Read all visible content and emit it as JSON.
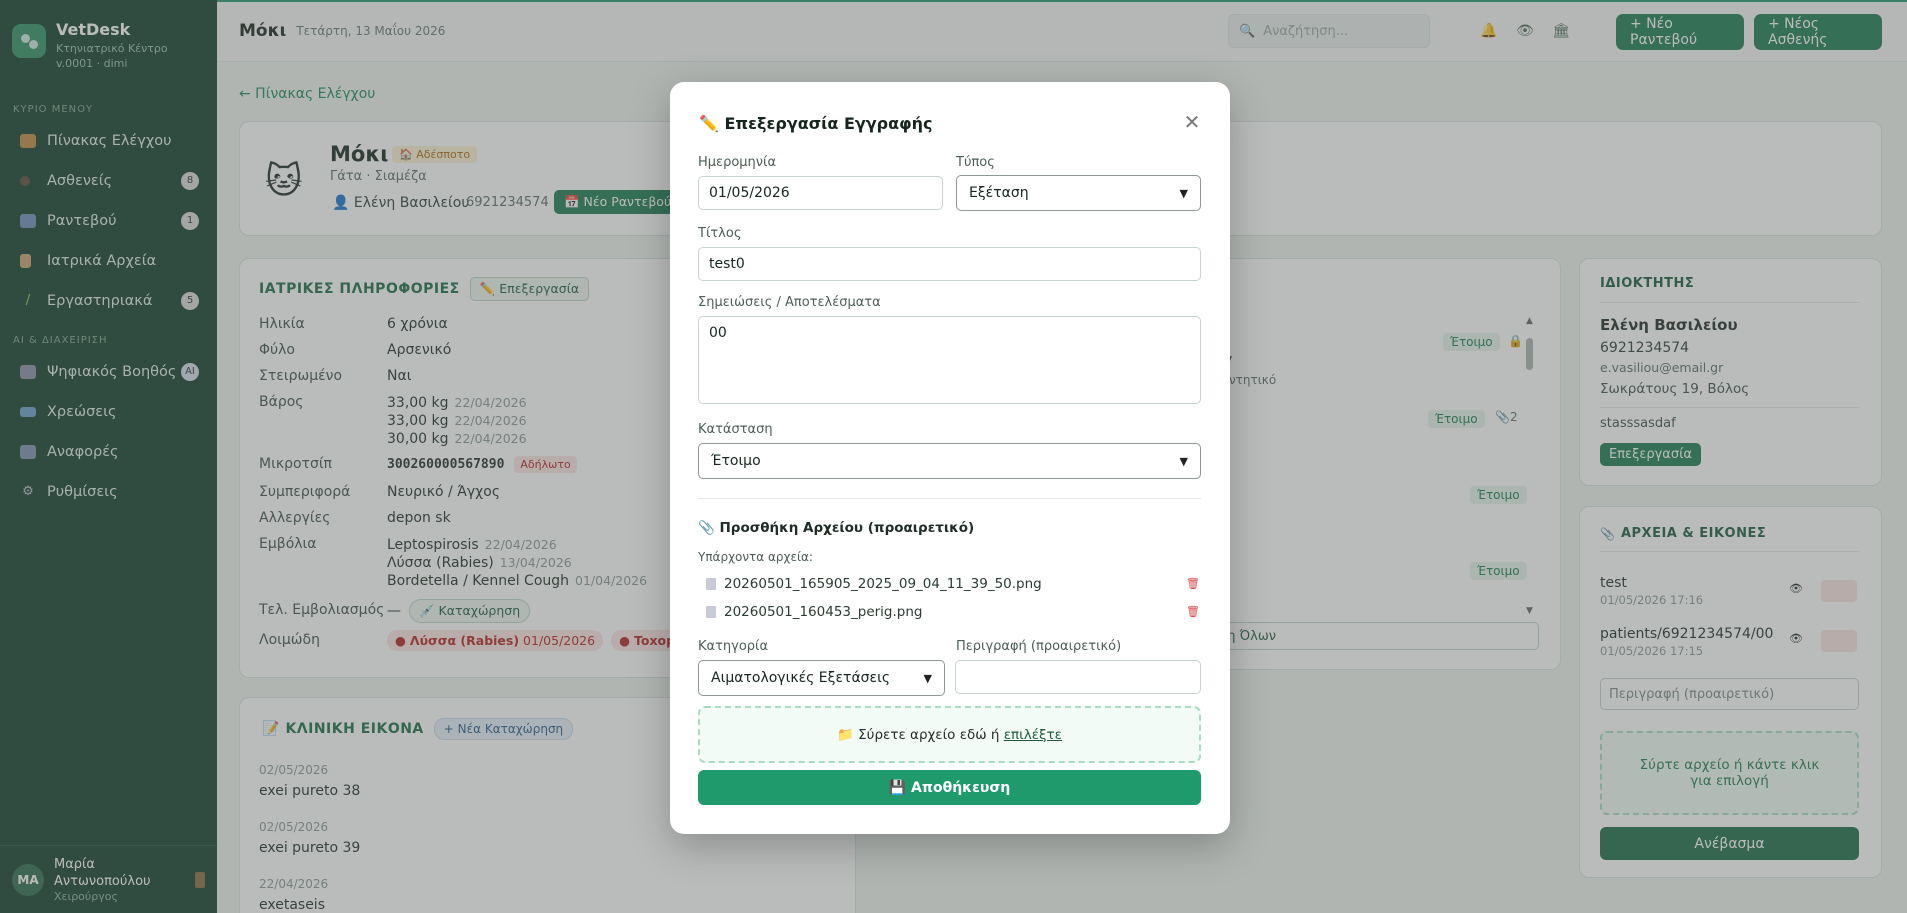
{
  "brand": {
    "name": "VetDesk",
    "subtitle": "Κτηνιατρικό Κέντρο",
    "version": "v.0001 · dimi"
  },
  "nav": {
    "section_main": "ΚΥΡΙΟ ΜΕΝΟΥ",
    "items_main": [
      {
        "label": "Πίνακας Ελέγχου",
        "icon": "dashboard-icon",
        "badge": ""
      },
      {
        "label": "Ασθενείς",
        "icon": "paw-icon",
        "badge": "8"
      },
      {
        "label": "Ραντεβού",
        "icon": "calendar-icon",
        "badge": "1"
      },
      {
        "label": "Ιατρικά Αρχεία",
        "icon": "clipboard-icon",
        "badge": ""
      },
      {
        "label": "Εργαστηριακά",
        "icon": "test-tube-icon",
        "badge": "5"
      }
    ],
    "section_ai": "AI & ΔΙΑΧΕΙΡΙΣΗ",
    "items_ai": [
      {
        "label": "Ψηφιακός Βοηθός",
        "icon": "robot-icon",
        "badge": "AI"
      },
      {
        "label": "Χρεώσεις",
        "icon": "card-icon",
        "badge": ""
      },
      {
        "label": "Αναφορές",
        "icon": "chart-icon",
        "badge": ""
      },
      {
        "label": "Ρυθμίσεις",
        "icon": "gear-icon",
        "badge": ""
      }
    ]
  },
  "user": {
    "initials": "MA",
    "name": "Μαρία Αντωνοπούλου",
    "role": "Χειρούργος"
  },
  "topbar": {
    "title": "Μόκι",
    "date": "Τετάρτη, 13 Μαΐου 2026",
    "search_placeholder": "Αναζήτηση...",
    "new_appointment": "+ Νέο Ραντεβού",
    "new_patient": "+ Νέος Ασθενής"
  },
  "back_link": "← Πίνακας Ελέγχου",
  "patient": {
    "name": "Μόκι",
    "badge": "🏠 Αδέσποτο",
    "species": "Γάτα · Σιαμέζα",
    "owner": "Ελένη Βασιλείου",
    "phone": "6921234574",
    "appt_btn": "Νέο Ραντεβού"
  },
  "medical": {
    "title": "ΙΑΤΡΙΚΕΣ ΠΛΗΡΟΦΟΡΙΕΣ",
    "edit_btn": "✏️ Επεξεργασία",
    "age_label": "Ηλικία",
    "age": "6 χρόνια",
    "sex_label": "Φύλο",
    "sex": "Αρσενικό",
    "neutered_label": "Στειρωμένο",
    "neutered": "Ναι",
    "weight_label": "Βάρος",
    "weights": [
      {
        "value": "33,00 kg",
        "date": "22/04/2026"
      },
      {
        "value": "33,00 kg",
        "date": "22/04/2026"
      },
      {
        "value": "30,00 kg",
        "date": "22/04/2026"
      }
    ],
    "chip_label": "Μικροτσίπ",
    "chip": "300260000567890",
    "chip_badge": "Αδήλωτο",
    "behavior_label": "Συμπεριφορά",
    "behavior": "Νευρικό / Άγχος",
    "allergies_label": "Αλλεργίες",
    "allergies": "depon sk",
    "vaccines_label": "Εμβόλια",
    "vaccines": [
      {
        "name": "Leptospirosis",
        "date": "22/04/2026"
      },
      {
        "name": "Λύσσα (Rabies)",
        "date": "13/04/2026"
      },
      {
        "name": "Bordetella / Kennel Cough",
        "date": "01/04/2026"
      }
    ],
    "last_vacc_label": "Τελ. Εμβολιασμός",
    "last_vacc": "—",
    "last_vacc_btn": "💉 Καταχώρηση",
    "infections_label": "Λοιμώδη",
    "infection1": "Λύσσα (Rabies)",
    "infection1_date": "01/05/2026",
    "infection2": "Toxoplas"
  },
  "clinical": {
    "title": "ΚΛΙΝΙΚΗ ΕΙΚΟΝΑ",
    "new_btn": "+ Νέα Καταχώρηση",
    "entries": [
      {
        "date": "02/05/2026",
        "text": "exei pureto 38"
      },
      {
        "date": "02/05/2026",
        "text": "exei pureto 39"
      },
      {
        "date": "22/04/2026",
        "text": "exetaseis"
      }
    ]
  },
  "middle": {
    "status1": "Έτοιμο",
    "line1": "y",
    "line2": "ροντητικό",
    "status2": "Έτοιμο",
    "attach2": "2",
    "status3": "Έτοιμο",
    "status4": "Έτοιμο",
    "show_all": "ση Όλων"
  },
  "owner": {
    "title": "ΙΔΙΟΚΤΗΤΗΣ",
    "name": "Ελένη Βασιλείου",
    "phone": "6921234574",
    "email": "e.vasiliou@email.gr",
    "address": "Σωκράτους 19, Βόλος",
    "note": "stasssasdaf",
    "edit_btn": "Επεξεργασία"
  },
  "files": {
    "title": "ΑΡΧΕΙΑ & ΕΙΚΟΝΕΣ",
    "items": [
      {
        "name": "test",
        "date": "01/05/2026 17:16"
      },
      {
        "name": "patients/6921234574/00...",
        "date": "01/05/2026 17:15"
      }
    ],
    "desc_placeholder": "Περιγραφή (προαιρετικό)",
    "drop_text": "Σύρτε αρχείο ή κάντε κλικ για επιλογή",
    "upload_btn": "Ανέβασμα"
  },
  "modal": {
    "title": "✏️ Επεξεργασία Εγγραφής",
    "date_label": "Ημερομηνία",
    "date_value": "01/05/2026",
    "type_label": "Τύπος",
    "type_value": "Εξέταση",
    "title_label": "Τίτλος",
    "title_value": "test0",
    "notes_label": "Σημειώσεις / Αποτελέσματα",
    "notes_value": "00",
    "status_label": "Κατάσταση",
    "status_value": "Έτοιμο",
    "attach_title": "📎 Προσθήκη Αρχείου (προαιρετικό)",
    "existing_label": "Υπάρχοντα αρχεία:",
    "existing_files": [
      "20260501_165905_2025_09_04_11_39_50.png",
      "20260501_160453_perig.png"
    ],
    "category_label": "Κατηγορία",
    "category_value": "Αιματολογικές Εξετάσεις",
    "desc_label": "Περιγραφή (προαιρετικό)",
    "desc_value": "",
    "drop_text": "📁 Σύρετε αρχείο εδώ ή ",
    "drop_link": "επιλέξτε",
    "save_btn": "💾 Αποθήκευση"
  }
}
